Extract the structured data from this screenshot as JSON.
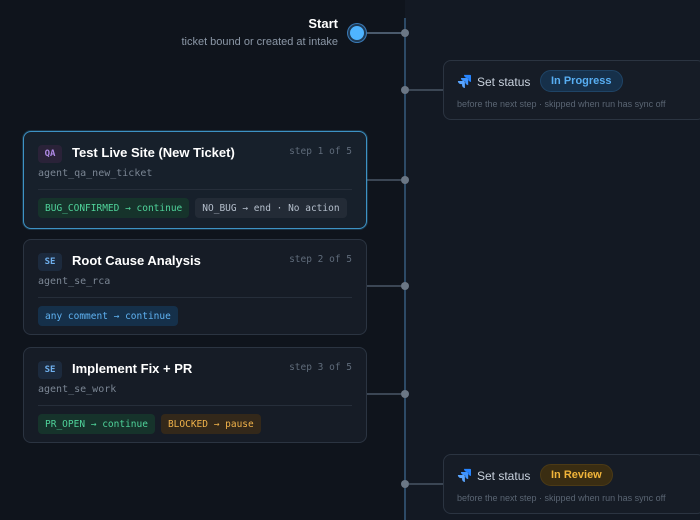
{
  "start": {
    "title": "Start",
    "subtitle": "ticket bound or created at intake"
  },
  "steps": [
    {
      "badge": "QA",
      "title": "Test Live Site (New Ticket)",
      "step_label": "step 1 of 5",
      "agent": "agent_qa_new_ticket",
      "chips": [
        {
          "label": "BUG_CONFIRMED → continue",
          "tone": "green"
        },
        {
          "label": "NO_BUG → end · No action",
          "tone": "gray"
        }
      ]
    },
    {
      "badge": "SE",
      "title": "Root Cause Analysis",
      "step_label": "step 2 of 5",
      "agent": "agent_se_rca",
      "chips": [
        {
          "label": "any comment → continue",
          "tone": "blue"
        }
      ]
    },
    {
      "badge": "SE",
      "title": "Implement Fix + PR",
      "step_label": "step 3 of 5",
      "agent": "agent_se_work",
      "chips": [
        {
          "label": "PR_OPEN → continue",
          "tone": "green"
        },
        {
          "label": "BLOCKED → pause",
          "tone": "amber"
        }
      ]
    }
  ],
  "status_actions": [
    {
      "icon": "jira-icon",
      "label": "Set status",
      "status": "In Progress",
      "note": "before the next step · skipped when run has sync off"
    },
    {
      "icon": "jira-icon",
      "label": "Set status",
      "status": "In Review",
      "note": "before the next step · skipped when run has sync off"
    }
  ],
  "colors": {
    "accent_blue": "#4fb4ff",
    "in_progress": "#58aef2",
    "in_review": "#f2b53a",
    "continue_green": "#4fd39a"
  }
}
